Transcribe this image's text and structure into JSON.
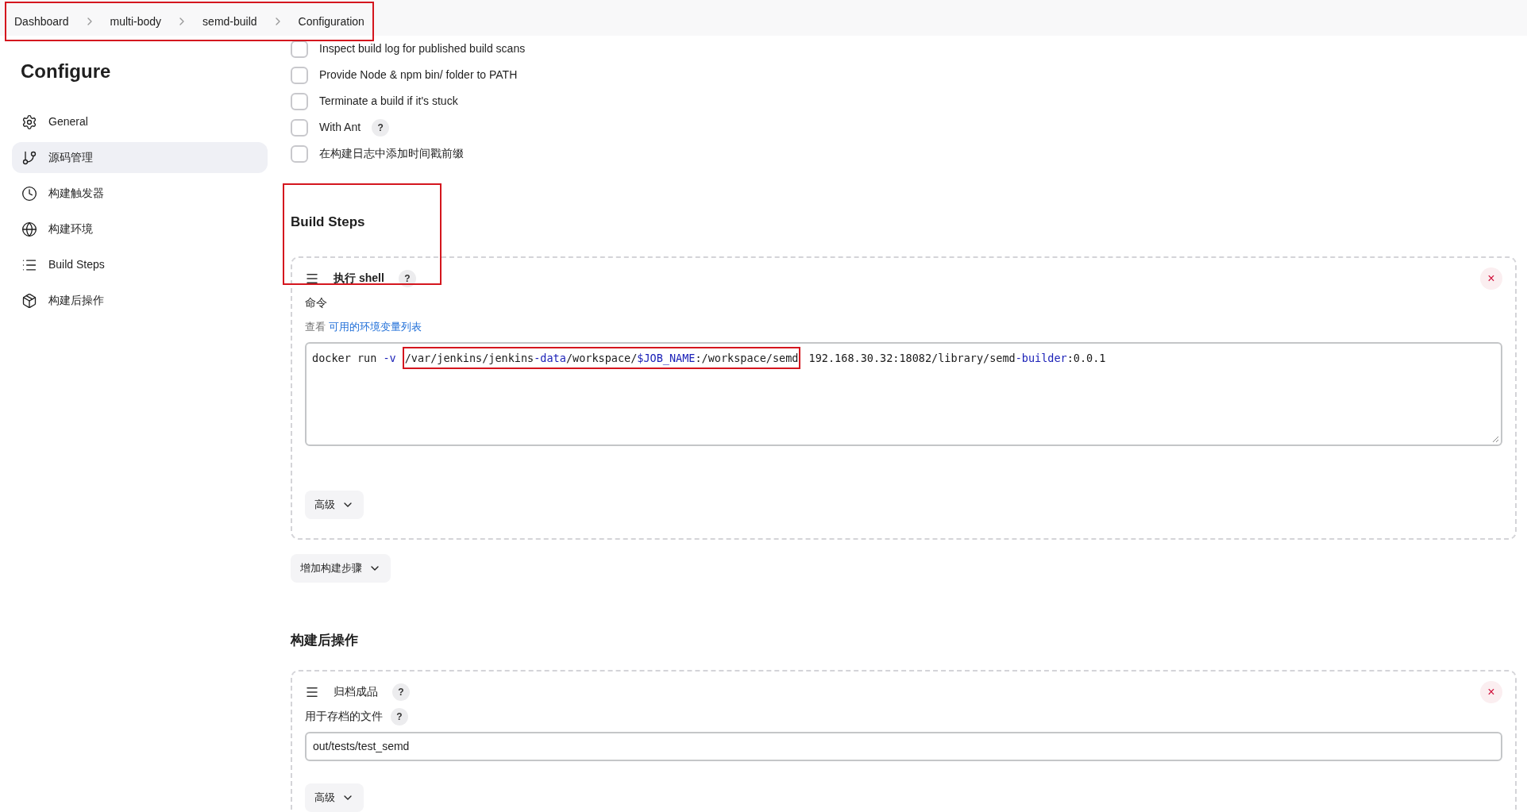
{
  "breadcrumb": {
    "highlighted": true,
    "items": [
      {
        "label": "Dashboard"
      },
      {
        "label": "multi-body"
      },
      {
        "label": "semd-build"
      },
      {
        "label": "Configuration"
      }
    ]
  },
  "sidebar": {
    "title": "Configure",
    "items": [
      {
        "label": "General",
        "selected": false
      },
      {
        "label": "源码管理",
        "selected": true
      },
      {
        "label": "构建触发器",
        "selected": false
      },
      {
        "label": "构建环境",
        "selected": false
      },
      {
        "label": "Build Steps",
        "selected": false
      },
      {
        "label": "构建后操作",
        "selected": false
      }
    ]
  },
  "options": [
    {
      "label": "Inspect build log for published build scans",
      "checked": false
    },
    {
      "label": "Provide Node & npm bin/ folder to PATH",
      "checked": false
    },
    {
      "label": "Terminate a build if it's stuck",
      "checked": false
    },
    {
      "label": "With Ant",
      "checked": false,
      "help": "?"
    },
    {
      "label": "在构建日志中添加时间戳前缀",
      "checked": false
    }
  ],
  "build_steps": {
    "title": "Build Steps",
    "highlighted": true,
    "step": {
      "title": "执行 shell",
      "help": "?",
      "close": "×",
      "field_label": "命令",
      "hint_prefix": "查看",
      "hint_link": "可用的环境变量列表",
      "command": [
        {
          "highlighted": false,
          "tokens": [
            {
              "text": "docker run ",
              "kind": "plain"
            },
            {
              "text": "-v",
              "kind": "keyword"
            }
          ]
        },
        {
          "highlighted": true,
          "tokens": [
            {
              "text": "/var/jenkins/jenkins",
              "kind": "plain"
            },
            {
              "text": "-data",
              "kind": "keyword"
            },
            {
              "text": "/workspace/",
              "kind": "plain"
            },
            {
              "text": "$JOB_NAME",
              "kind": "keyword"
            },
            {
              "text": ":/workspace/semd",
              "kind": "plain"
            }
          ]
        },
        {
          "highlighted": false,
          "tokens": [
            {
              "text": " 192.168.30.32:18082/library/semd",
              "kind": "plain"
            },
            {
              "text": "-builder",
              "kind": "keyword"
            },
            {
              "text": ":0.0.1",
              "kind": "plain"
            }
          ]
        }
      ],
      "advanced": "高级"
    },
    "add_button": "增加构建步骤"
  },
  "post_build": {
    "title": "构建后操作",
    "step": {
      "title": "归档成品",
      "help": "?",
      "close": "×",
      "field_label": "用于存档的文件",
      "field_help": "?",
      "value": "out/tests/test_semd",
      "advanced": "高级"
    }
  }
}
